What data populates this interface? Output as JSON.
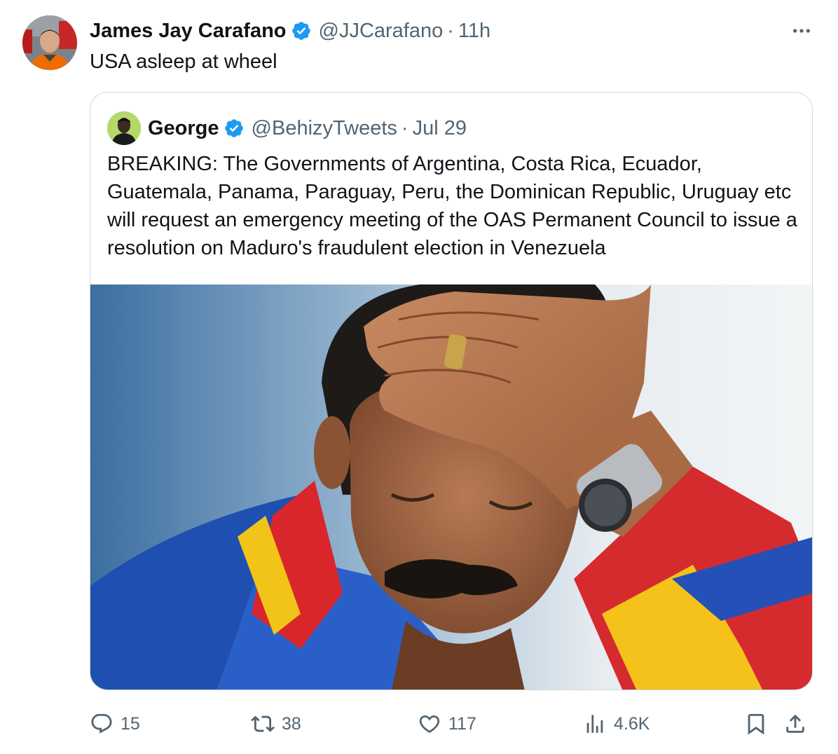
{
  "tweet": {
    "author": {
      "display_name": "James Jay Carafano",
      "handle": "@JJCarafano",
      "verified": true,
      "avatar_icon": "person-avatar"
    },
    "separator": "·",
    "timestamp": "11h",
    "text": "USA asleep at wheel",
    "more_icon": "more-horizontal-icon"
  },
  "quoted_tweet": {
    "author": {
      "display_name": "George",
      "handle": "@BehizyTweets",
      "verified": true,
      "avatar_icon": "person-avatar"
    },
    "separator": "·",
    "timestamp": "Jul 29",
    "text": "BREAKING: The Governments of Argentina, Costa Rica, Ecuador, Guatemala, Panama, Paraguay, Peru, the Dominican Republic, Uruguay etc will request an emergency meeting of the OAS Permanent Council to issue a resolution on Maduro's fraudulent election in Venezuela",
    "image_icon": "photo-man-hand-on-forehead"
  },
  "actions": {
    "reply": {
      "icon": "reply-icon",
      "count": "15"
    },
    "repost": {
      "icon": "repost-icon",
      "count": "38"
    },
    "like": {
      "icon": "heart-icon",
      "count": "117"
    },
    "views": {
      "icon": "views-chart-icon",
      "count": "4.6K"
    },
    "bookmark": {
      "icon": "bookmark-icon"
    },
    "share": {
      "icon": "share-icon"
    }
  },
  "colors": {
    "text_primary": "#0f1419",
    "text_secondary": "#536471",
    "verified_blue": "#1d9bf0",
    "border": "#cfd9de"
  }
}
